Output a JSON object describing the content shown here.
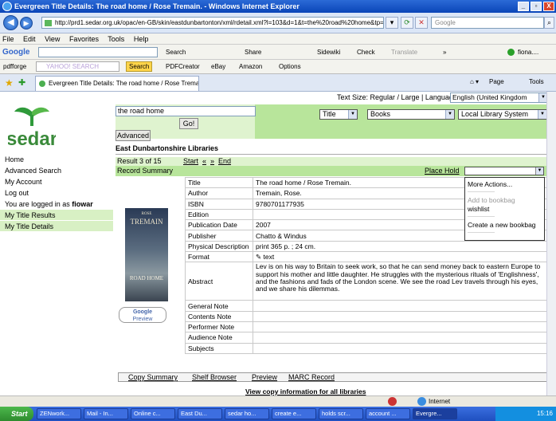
{
  "window": {
    "title": "Evergreen Title Details: The road home / Rose Tremain. - Windows Internet Explorer",
    "controls": [
      "_",
      "▫",
      "X"
    ]
  },
  "addressbar": {
    "url": "http://prd1.sedar.org.uk/opac/en-GB/skin/eastdunbartonton/xml/rdetail.xml?l=103&d=1&t=the%20road%20home&tp=title&f=",
    "search_placeholder": "Google"
  },
  "menu": [
    "File",
    "Edit",
    "View",
    "Favorites",
    "Tools",
    "Help"
  ],
  "google_toolbar": {
    "brand": "Google",
    "search": "Search",
    "share": "Share",
    "sidewiki": "Sidewiki",
    "check": "Check",
    "translate": "Translate",
    "more": "»",
    "user": "fiona...."
  },
  "yahoo_toolbar": {
    "pdfforge": "pdfforge",
    "yahoo": "YAHOO! SEARCH",
    "search": "Search",
    "pdfcreator": "PDFCreator",
    "ebay": "eBay",
    "amazon": "Amazon",
    "options": "Options"
  },
  "tab": {
    "label": "Evergreen Title Details: The road home / Rose Tremain.",
    "page": "Page",
    "tools": "Tools"
  },
  "header": {
    "text_size": "Text Size: Regular / Large | Language:",
    "language": "English (United Kingdom"
  },
  "search": {
    "query": "the road home",
    "go": "Go!",
    "type": "Title",
    "format": "Books",
    "library": "Local Library System",
    "advanced": "Advanced"
  },
  "library_name": "East Dunbartonshire Libraries",
  "sidebar": {
    "items": [
      {
        "label": "Home"
      },
      {
        "label": "Advanced Search"
      },
      {
        "label": "My Account"
      },
      {
        "label": "Log out"
      },
      {
        "label": "My Title Results"
      },
      {
        "label": "My Title Details"
      }
    ],
    "logged_in_prefix": "You are logged in as ",
    "username": "fiowar"
  },
  "result_nav": {
    "result": "Result 3 of 15",
    "start": "Start",
    "prev": "«",
    "next": "»",
    "end": "End"
  },
  "summary": {
    "label": "Record Summary",
    "place_hold": "Place Hold"
  },
  "actions_dropdown": {
    "more_actions": "More Actions...",
    "separator1": "-----------------",
    "add_to_bookbag": "Add to bookbag",
    "wishlist": "wishlist",
    "separator2": "-----------------",
    "create_bookbag": "Create a new bookbag",
    "separator3": "-----------------"
  },
  "cover": {
    "author": "ROSE",
    "surname": "TREMAIN",
    "title_text": "ROAD HOME"
  },
  "google_preview": {
    "line1": "Google",
    "line2": "Preview"
  },
  "record": {
    "rows": [
      {
        "key": "Title",
        "value": "The road home / Rose Tremain."
      },
      {
        "key": "Author",
        "value": "Tremain, Rose."
      },
      {
        "key": "ISBN",
        "value": "9780701177935"
      },
      {
        "key": "Edition",
        "value": ""
      },
      {
        "key": "Publication Date",
        "value": "2007"
      },
      {
        "key": "Publisher",
        "value": "Chatto & Windus"
      },
      {
        "key": "Physical Description",
        "value": "print 365 p. ; 24 cm."
      },
      {
        "key": "Format",
        "value": "text"
      },
      {
        "key": "Abstract",
        "value": "Lev is on his way to Britain to seek work, so that he can send money back to eastern Europe to support his mother and little daughter. He struggles with the mysterious rituals of 'Englishness', and the fashions and fads of the London scene. We see the road Lev travels through his eyes, and we share his dilemmas."
      },
      {
        "key": "General Note",
        "value": ""
      },
      {
        "key": "Contents Note",
        "value": ""
      },
      {
        "key": "Performer Note",
        "value": ""
      },
      {
        "key": "Audience Note",
        "value": ""
      },
      {
        "key": "Subjects",
        "value": ""
      }
    ]
  },
  "bottom_tabs": [
    "Copy Summary",
    "Shelf Browser",
    "Preview",
    "MARC Record"
  ],
  "view_copy": "View copy information for all libraries",
  "status": {
    "zone": "Internet"
  },
  "taskbar": {
    "start": "Start",
    "tasks": [
      "ZENwork...",
      "Mail - In...",
      "Online c...",
      "East Du...",
      "sedar ho...",
      "create e...",
      "holds scr...",
      "account ...",
      "Evergre..."
    ],
    "clock": "15:16"
  }
}
